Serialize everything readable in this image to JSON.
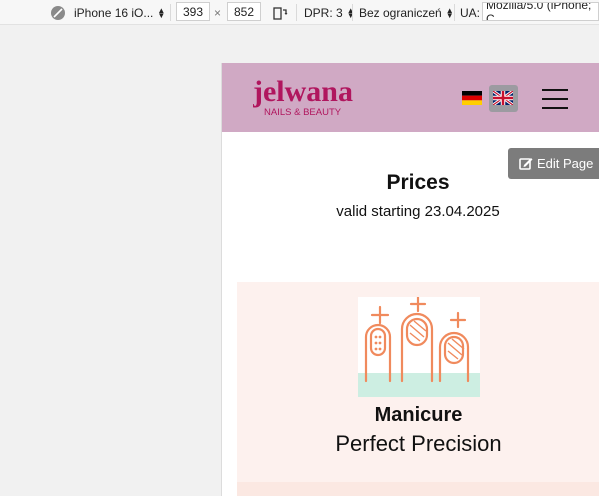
{
  "toolbar": {
    "device": "iPhone 16 iO...",
    "width": "393",
    "times": "×",
    "height": "852",
    "dpr": "DPR: 3",
    "throttle": "Bez ograniczeń",
    "ua_label": "UA:",
    "ua_value": "Mozilla/5.0 (iPhone; C"
  },
  "site": {
    "logo_main": "jelwana",
    "logo_sub": "NAILS & BEAUTY",
    "edit_label": "Edit Page"
  },
  "prices": {
    "title": "Prices",
    "subtitle": "valid starting 23.04.2025"
  },
  "card": {
    "title": "Manicure",
    "subtitle": "Perfect Precision"
  },
  "colors": {
    "header_bg": "#d0a9c4",
    "logo": "#b0165e",
    "card_bg": "#fdf1ee",
    "icon_stroke": "#f08a5d",
    "icon_base": "#cdeee2"
  }
}
